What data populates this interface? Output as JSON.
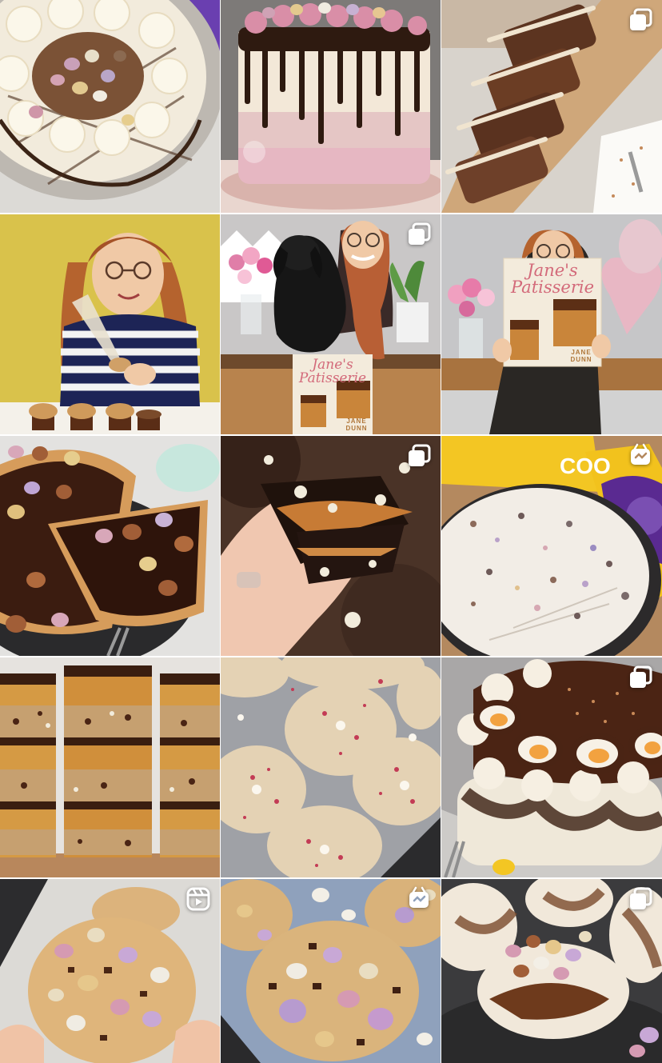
{
  "grid": {
    "posts": [
      {
        "id": "post-1",
        "subject": "mini-egg-cheesecake",
        "badge": "none"
      },
      {
        "id": "post-2",
        "subject": "pink-drip-cake",
        "badge": "none"
      },
      {
        "id": "post-3",
        "subject": "loaf-cake-slices",
        "badge": "carousel-icon"
      },
      {
        "id": "post-4",
        "subject": "piping-cupcakes",
        "badge": "none"
      },
      {
        "id": "post-5",
        "subject": "puppy-book",
        "badge": "carousel-icon",
        "book": {
          "title_line1": "Jane's",
          "title_line2": "Patisserie",
          "author_line1": "JANE",
          "author_line2": "DUNN"
        }
      },
      {
        "id": "post-6",
        "subject": "book-balloon",
        "badge": "none",
        "book": {
          "title_line1": "Jane's",
          "title_line2": "Patisserie",
          "author_line1": "JANE",
          "author_line2": "DUNN"
        }
      },
      {
        "id": "post-7",
        "subject": "egg-tart",
        "badge": "none"
      },
      {
        "id": "post-8",
        "subject": "stuffed-cookie",
        "badge": "carousel-icon"
      },
      {
        "id": "post-9",
        "subject": "mini-egg-cheesecake-top",
        "badge": "clip-icon",
        "pack_text": "COO"
      },
      {
        "id": "post-10",
        "subject": "millionaire-bars",
        "badge": "none"
      },
      {
        "id": "post-11",
        "subject": "raspberry-cookies",
        "badge": "none"
      },
      {
        "id": "post-12",
        "subject": "creme-egg-cheesecake",
        "badge": "carousel-icon"
      },
      {
        "id": "post-13",
        "subject": "mini-egg-cookie",
        "badge": "reel-icon"
      },
      {
        "id": "post-14",
        "subject": "mini-egg-cookies",
        "badge": "clip-icon"
      },
      {
        "id": "post-15",
        "subject": "pavlova",
        "badge": "carousel-icon"
      }
    ]
  },
  "colors": {
    "badge": "#ffffff",
    "background": "#ffffff"
  }
}
